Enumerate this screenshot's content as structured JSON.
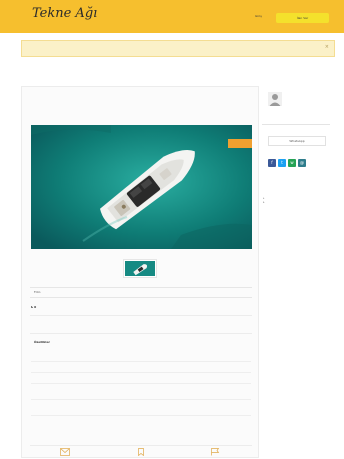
{
  "header": {
    "logo_text": "Tekne Ağı",
    "login_label": "Giriş",
    "post_ad_label": "İlan Ver"
  },
  "main": {
    "photo_tab_label": "Foto",
    "price_label": "₺ 0",
    "specs_title": "Özellikler"
  },
  "sidebar": {
    "whatsapp_label": "WhatsApp"
  },
  "icons": {
    "bottom": [
      "mail-icon",
      "bookmark-icon",
      "flag-icon"
    ],
    "share": [
      "facebook-icon",
      "twitter-icon",
      "whatsapp-icon",
      "email-icon"
    ]
  },
  "colors": {
    "brand": "#f6bf2e",
    "accent": "#e8a03a",
    "post_ad": "#f4e12c",
    "notice_bg": "#fbf1c8",
    "sea": "#0f7a73",
    "facebook": "#3b5998",
    "twitter": "#1da1f2",
    "whatsapp": "#25a356",
    "email": "#2f7d8c"
  }
}
